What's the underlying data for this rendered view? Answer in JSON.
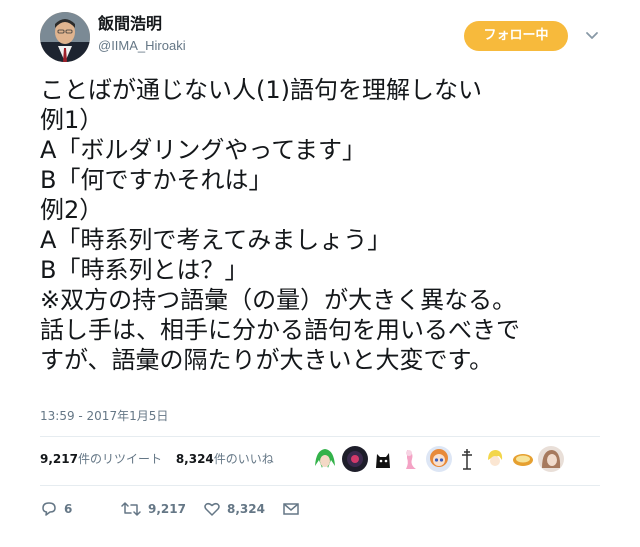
{
  "author": {
    "name": "飯間浩明",
    "handle": "@IIMA_Hiroaki"
  },
  "follow_label": "フォロー中",
  "tweet": {
    "lines": [
      "ことばが通じない人(1)語句を理解しない",
      "例1）",
      "A「ボルダリングやってます」",
      "B「何ですかそれは」",
      "例2）",
      "A「時系列で考えてみましょう」",
      "B「時系列とは？」",
      "※双方の持つ語彙（の量）が大きく異なる。",
      "話し手は、相手に分かる語句を用いるべきで",
      "すが、語彙の隔たりが大きいと大変です。"
    ],
    "timestamp": "13:59 - 2017年1月5日"
  },
  "stats": {
    "retweet_count": "9,217",
    "retweet_label": "件のリツイート",
    "like_count": "8,324",
    "like_label": "件のいいね"
  },
  "likers": [
    "green-hair-avatar",
    "dark-disc-avatar",
    "black-cat-avatar",
    "pink-mermaid-avatar",
    "anime-girl-avatar",
    "antenna-figure-avatar",
    "blonde-chibi-avatar",
    "pudding-avatar",
    "brown-hair-avatar"
  ],
  "actions": {
    "reply_count": "6",
    "retweet_count": "9,217",
    "like_count": "8,324"
  },
  "colors": {
    "follow_button": "#f7ba3c",
    "secondary_text": "#657786",
    "divider": "#e6ecf0"
  }
}
